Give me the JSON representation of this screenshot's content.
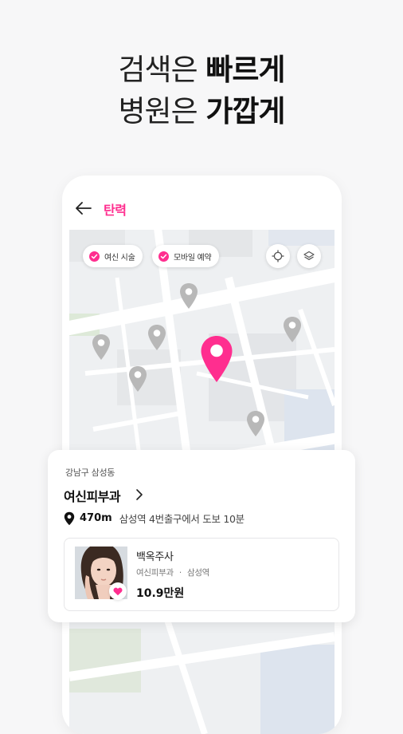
{
  "headline": {
    "line1_light": "검색은 ",
    "line1_bold": "빠르게",
    "line2_light": "병원은 ",
    "line2_bold": "가깝게"
  },
  "appbar": {
    "back_icon": "arrow-left-icon",
    "title": "탄력"
  },
  "filters": [
    {
      "label": "여신 시술",
      "checked": true
    },
    {
      "label": "모바일 예약",
      "checked": true
    }
  ],
  "map_controls": {
    "locate_icon": "crosshair-icon",
    "layers_icon": "layers-icon"
  },
  "clinic": {
    "region": "강남구 삼성동",
    "name": "여신피부과",
    "distance": "470m",
    "direction": "삼성역 4번출구에서 도보 10분"
  },
  "product": {
    "name": "백옥주사",
    "clinic": "여신피부과",
    "separator": "·",
    "station": "삼성역",
    "price": "10.9만원"
  },
  "colors": {
    "accent": "#ff2e8f",
    "pin_gray": "#b8b8b8",
    "map_bg": "#eef0f2"
  }
}
